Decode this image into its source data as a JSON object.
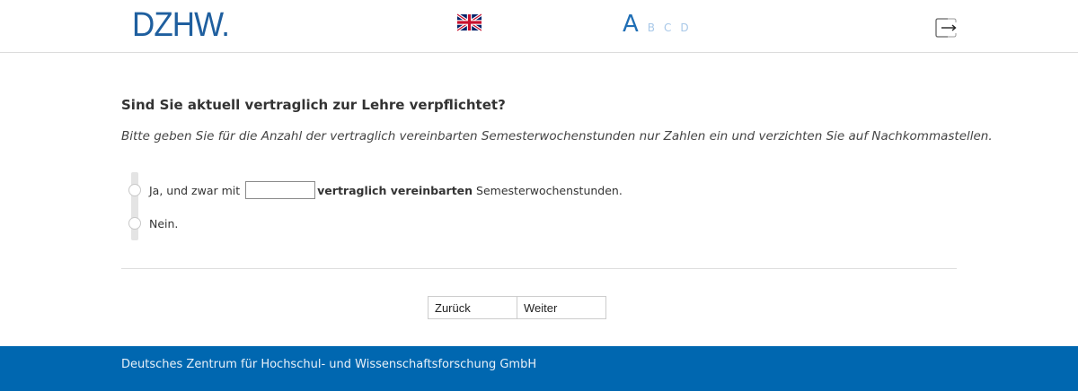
{
  "header": {
    "logo_text": "DZHW",
    "logo_dot": ".",
    "language_flag": "uk-flag-icon",
    "font_sizes": [
      "A",
      "B",
      "C",
      "D"
    ],
    "exit_icon": "exit-icon"
  },
  "question": {
    "title": "Sind Sie aktuell vertraglich zur Lehre verpflichtet?",
    "instruction": "Bitte geben Sie für die Anzahl der vertraglich vereinbarten Semesterwochenstunden nur Zahlen ein und verzichten Sie auf Nachkommastellen.",
    "options": [
      {
        "prefix": "Ja, und zwar mit",
        "input_value": "",
        "bold_text": "vertraglich vereinbarten",
        "suffix": " Semesterwochenstunden."
      },
      {
        "label": "Nein."
      }
    ]
  },
  "navigation": {
    "back_label": "Zurück",
    "next_label": "Weiter"
  },
  "footer": {
    "text": "Deutsches Zentrum für Hochschul- und Wissenschaftsforschung GmbH"
  },
  "colors": {
    "brand_blue": "#0067b0",
    "logo_blue": "#1f5f9f"
  }
}
